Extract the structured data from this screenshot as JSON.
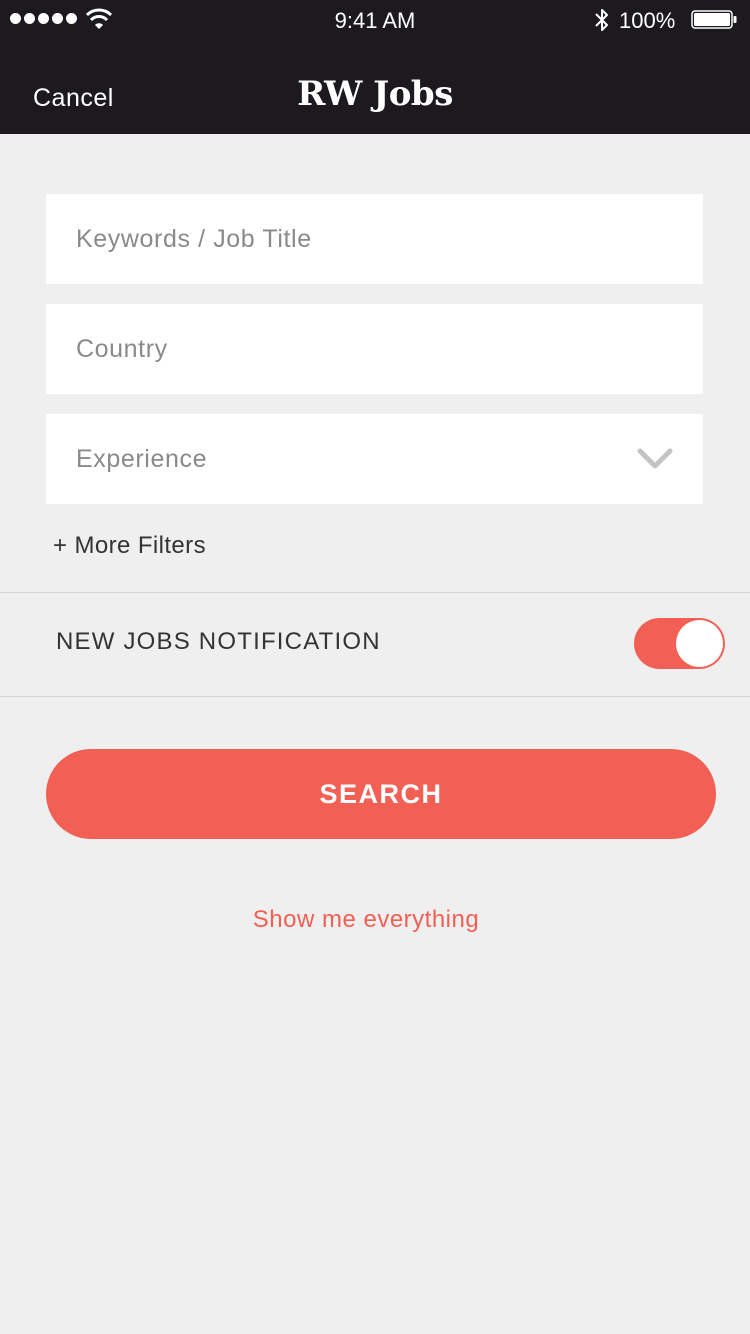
{
  "status_bar": {
    "time": "9:41 AM",
    "battery_percent": "100%",
    "signal_bars": 5,
    "icons": [
      "signal-icon",
      "wifi-icon",
      "bluetooth-icon",
      "battery-icon"
    ]
  },
  "nav": {
    "cancel_label": "Cancel",
    "title": "RW Jobs"
  },
  "form": {
    "keywords_placeholder": "Keywords / Job Title",
    "country_placeholder": "Country",
    "experience_placeholder": "Experience",
    "more_filters_label": "+ More Filters"
  },
  "notification": {
    "label": "NEW JOBS NOTIFICATION",
    "enabled": true
  },
  "actions": {
    "search_label": "SEARCH",
    "show_all_label": "Show me everything"
  },
  "colors": {
    "accent": "#f25f54",
    "header_bg": "#1c1a1f",
    "page_bg": "#efefef"
  }
}
